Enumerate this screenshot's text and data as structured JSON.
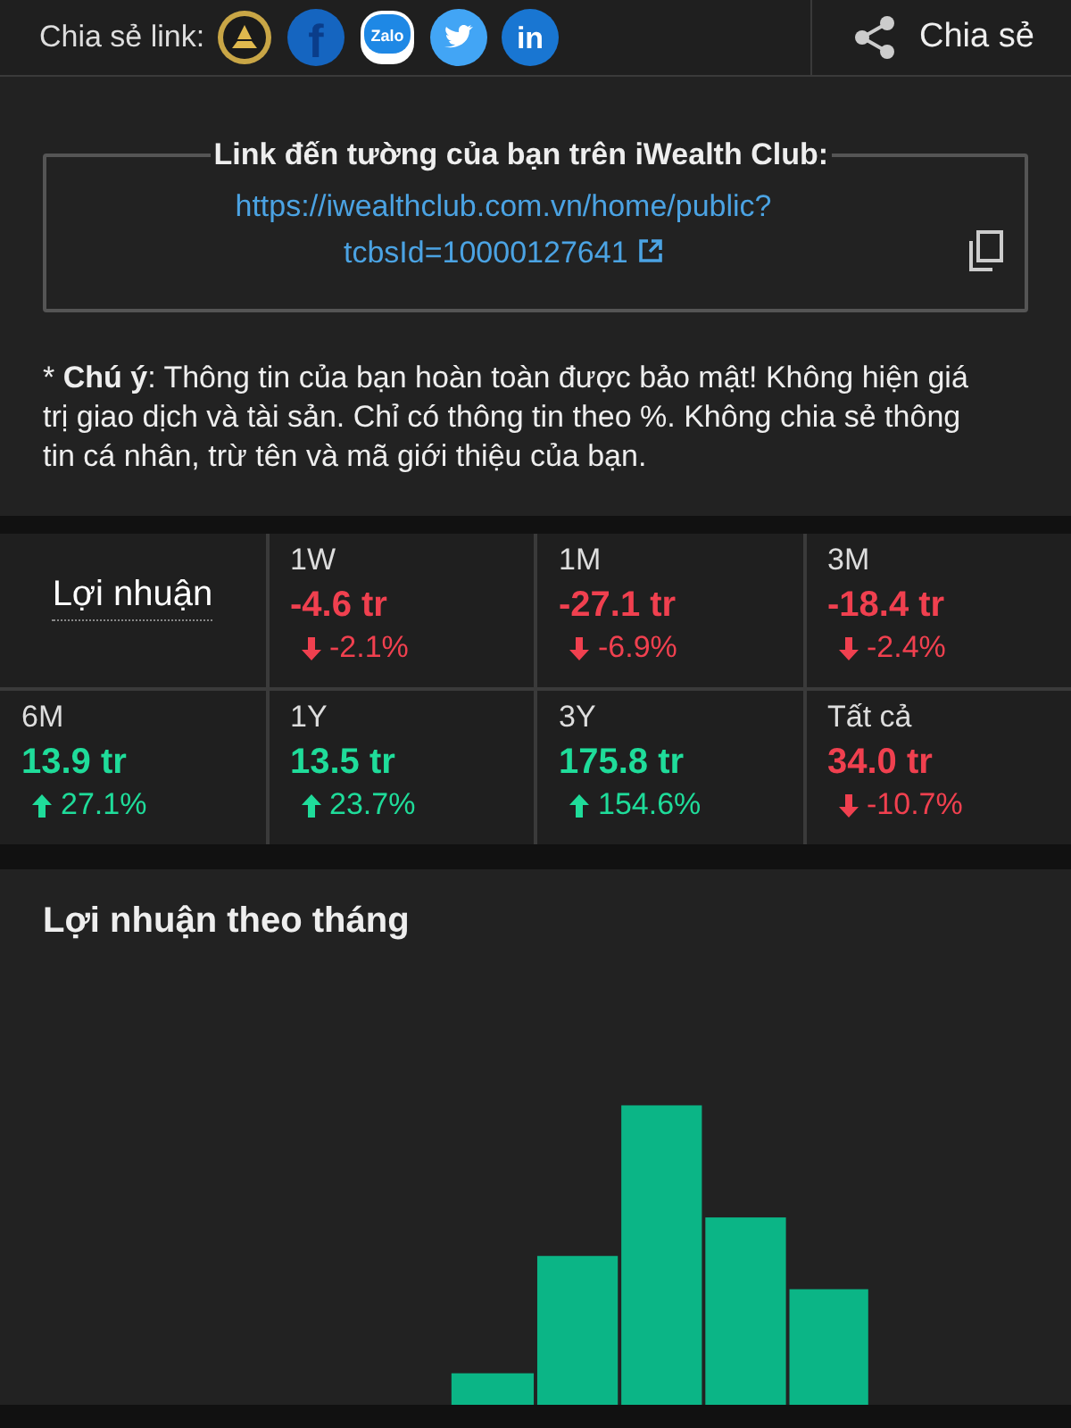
{
  "share_bar": {
    "label": "Chia sẻ link:",
    "icons": [
      {
        "kind": "emblem"
      },
      {
        "kind": "letter",
        "text": "f",
        "color": "#1565c0"
      },
      {
        "kind": "badge",
        "text": "Zalo",
        "color": "#1e88e5"
      },
      {
        "kind": "bird",
        "color": "#42a5f5"
      },
      {
        "kind": "letter",
        "text": "in",
        "color": "#1976d2"
      }
    ],
    "share_button": "Chia sẻ"
  },
  "link_box": {
    "legend": "Link đến tường của bạn trên iWealth Club:",
    "url_lines": [
      "https://iwealthclub.com.vn/home/public?",
      "tcbsId=10000127641"
    ]
  },
  "note": {
    "text": "* **Chú ý**: Thông tin của bạn hoàn toàn được bảo mật! Không hiện giá trị giao dịch và tài sản. Chỉ có thông tin theo %. Không chia sẻ thông tin cá nhân, trừ tên và mã giới thiệu của bạn."
  },
  "profit": {
    "title": "Lợi nhuận",
    "periods": [
      {
        "label": "1W",
        "value": "-4.6 tr",
        "change": "-2.1%",
        "gain": false
      },
      {
        "label": "1M",
        "value": "-27.1 tr",
        "change": "-6.9%",
        "gain": false
      },
      {
        "label": "3M",
        "value": "-18.4 tr",
        "change": "-2.4%",
        "gain": false
      },
      {
        "label": "6M",
        "value": "13.9 tr",
        "change": "27.1%",
        "gain": true
      },
      {
        "label": "1Y",
        "value": "13.5 tr",
        "change": "23.7%",
        "gain": true
      },
      {
        "label": "3Y",
        "value": "175.8 tr",
        "change": "154.6%",
        "gain": true
      },
      {
        "label": "Tất cả",
        "value": "34.0 tr",
        "change": "-10.7%",
        "gain": false
      }
    ]
  },
  "monthly": {
    "title": "Lợi nhuận theo tháng"
  }
}
